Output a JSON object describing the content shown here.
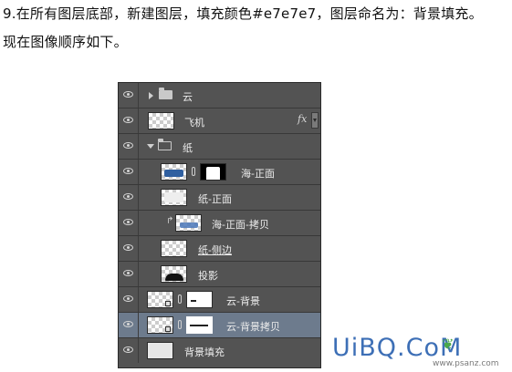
{
  "tutorial": {
    "line1": "9.在所有图层底部，新建图层，填充颜色#e7e7e7，图层命名为：背景填充。",
    "line2": "现在图像顺序如下。"
  },
  "layers_panel": {
    "layers": [
      {
        "name": "云",
        "kind": "group-collapsed"
      },
      {
        "name": "飞机",
        "kind": "layer-fx",
        "fx": "fx"
      },
      {
        "name": "纸",
        "kind": "group-expanded"
      },
      {
        "name": "海-正面",
        "kind": "layer-with-mask"
      },
      {
        "name": "纸-正面",
        "kind": "layer"
      },
      {
        "name": "海-正面-拷贝",
        "kind": "clipped-layer",
        "clip_glyph": "↱"
      },
      {
        "name": "纸-侧边",
        "kind": "layer"
      },
      {
        "name": "投影",
        "kind": "layer"
      },
      {
        "name": "云-背景",
        "kind": "smart-with-mask"
      },
      {
        "name": "云-背景拷贝",
        "kind": "smart-with-mask",
        "selected": true
      },
      {
        "name": "背景填充",
        "kind": "layer-solid",
        "fill_color": "#e7e7e7"
      }
    ],
    "colors": {
      "panel_bg": "#535353",
      "selected_bg": "#6d7b8d",
      "text": "#ececec"
    }
  },
  "watermark": {
    "logo": "UiBQ.CoM",
    "url": "www.psanz.com"
  }
}
